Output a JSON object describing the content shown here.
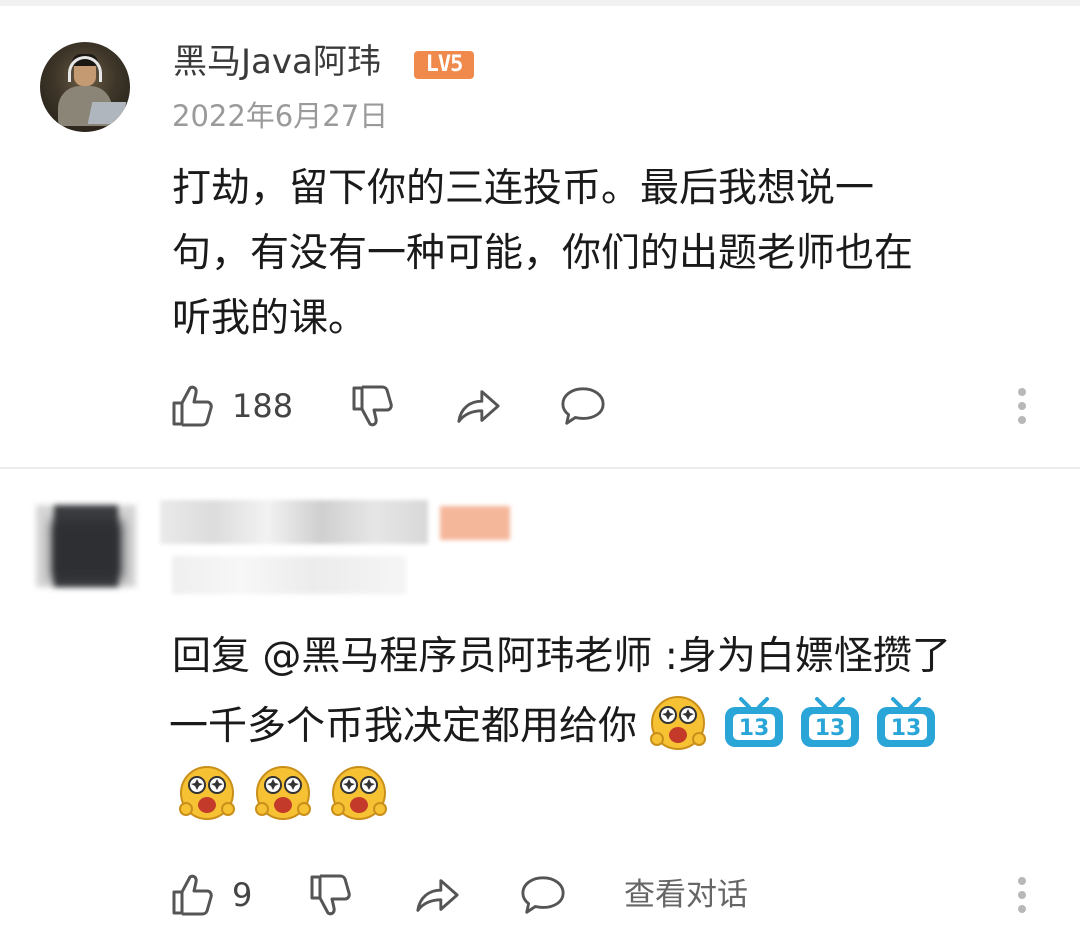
{
  "comment1": {
    "author": "黑马Java阿玮",
    "level_badge": "LV5",
    "date": "2022年6月27日",
    "text_lines": [
      "打劫，留下你的三连投币。最后我想说一",
      "句，有没有一种可能，你们的出题老师也在",
      "听我的课。"
    ],
    "actions": {
      "like_icon": "thumb-up-icon",
      "like_count": "188",
      "dislike_icon": "thumb-down-icon",
      "share_icon": "share-icon",
      "reply_icon": "comment-icon",
      "more_icon": "more-vertical-icon"
    }
  },
  "comment2": {
    "author_blurred": true,
    "text_line1": "回复 @黑马程序员阿玮老师 :身为白嫖怪攒了",
    "text_line2": "一千多个币我决定都用给你",
    "emojis_line2": [
      "starry-eyes-emoji",
      "tv-13-emoji",
      "tv-13-emoji",
      "tv-13-emoji"
    ],
    "emojis_line3": [
      "starry-eyes-emoji",
      "starry-eyes-emoji",
      "starry-eyes-emoji"
    ],
    "actions": {
      "like_icon": "thumb-up-icon",
      "like_count": "9",
      "dislike_icon": "thumb-down-icon",
      "share_icon": "share-icon",
      "reply_icon": "comment-icon",
      "view_dialog": "查看对话",
      "more_icon": "more-vertical-icon"
    }
  },
  "colors": {
    "level_badge": "#f08a4c",
    "emoji_tv": "#2aa5d8",
    "emoji_face": "#f6c234"
  }
}
